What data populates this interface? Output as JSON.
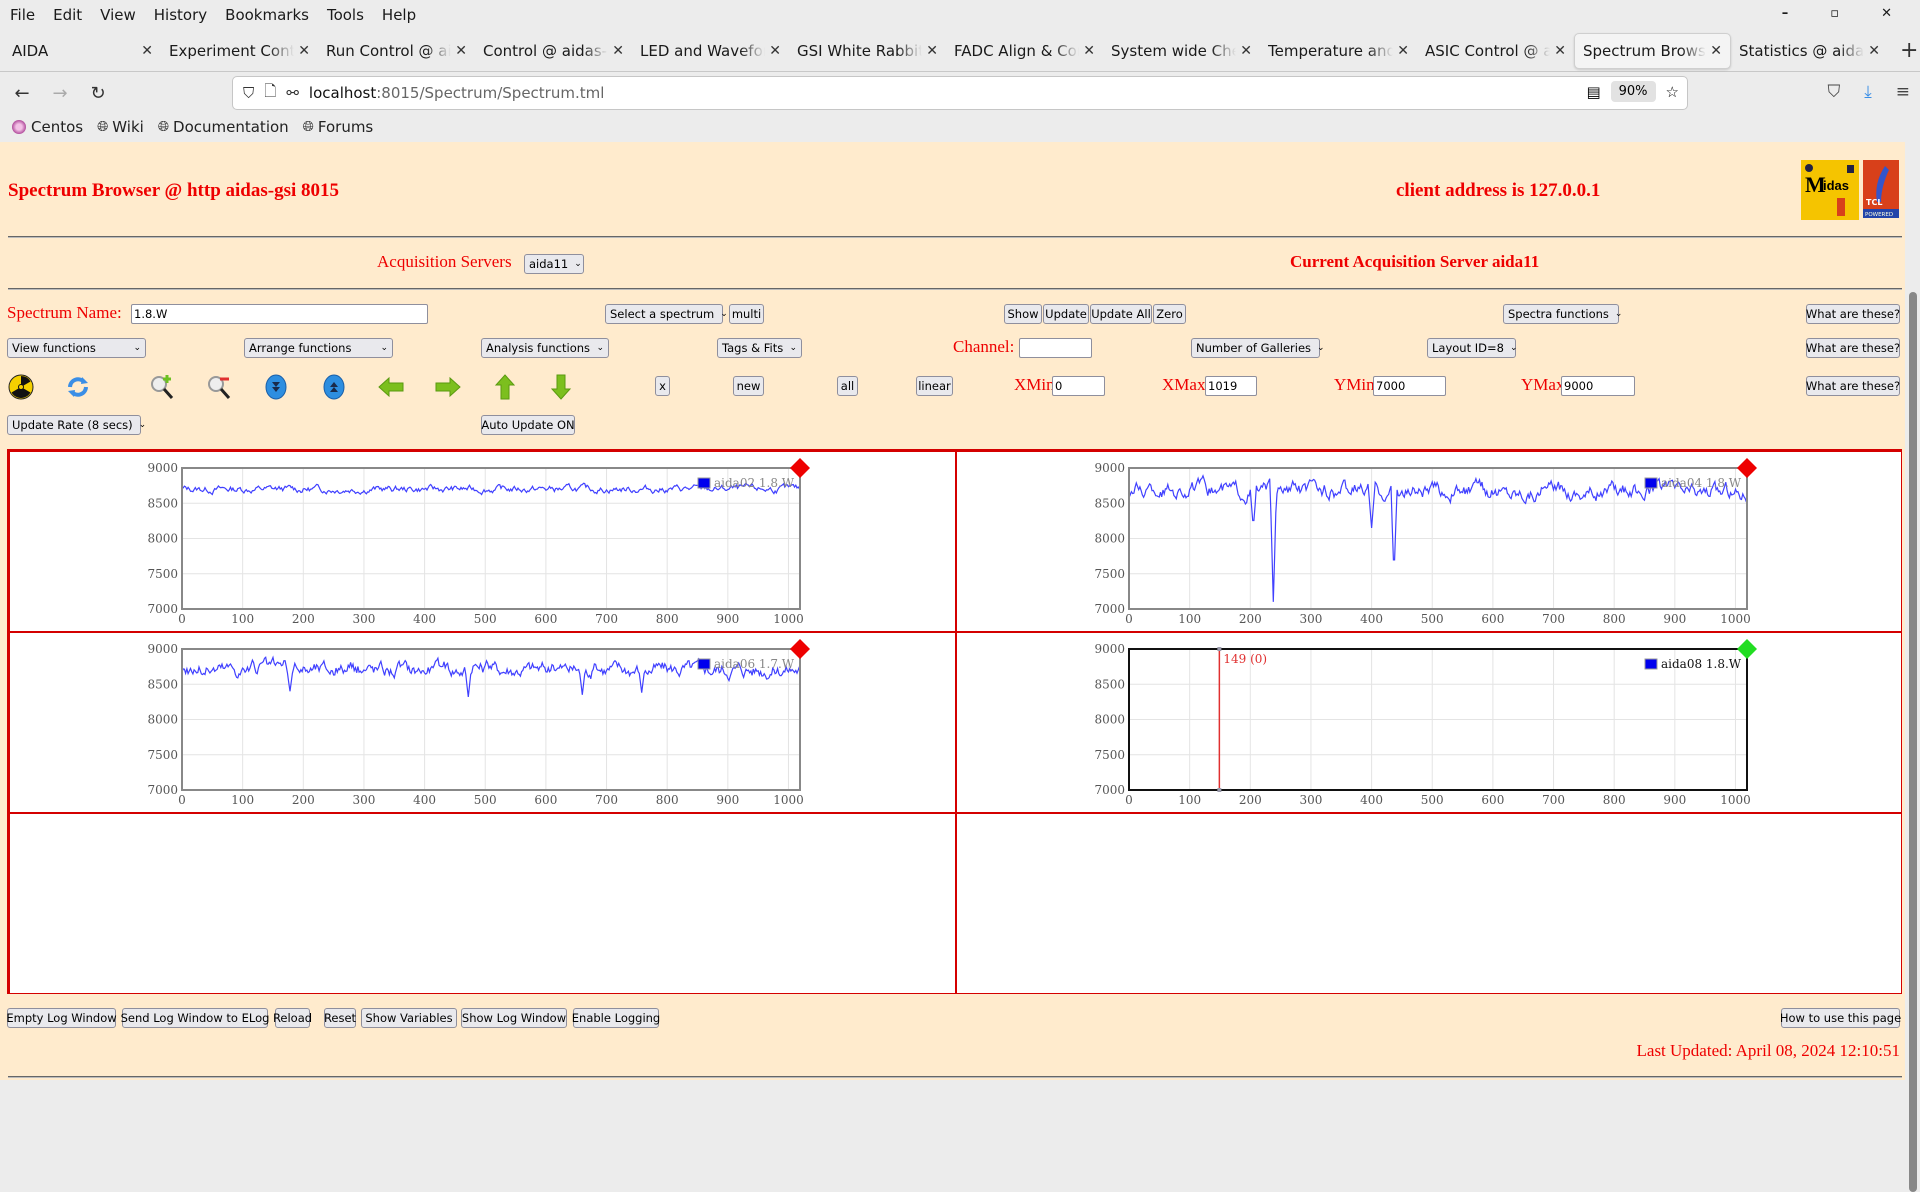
{
  "browser": {
    "menu": [
      "File",
      "Edit",
      "View",
      "History",
      "Bookmarks",
      "Tools",
      "Help"
    ],
    "window_controls": [
      "minimize",
      "maximize",
      "close"
    ],
    "tabs": [
      {
        "label": "AIDA",
        "active": false
      },
      {
        "label": "Experiment Control",
        "active": false
      },
      {
        "label": "Run Control @ aidas",
        "active": false
      },
      {
        "label": "Control @ aidas-gsi",
        "active": false
      },
      {
        "label": "LED and Waveform",
        "active": false
      },
      {
        "label": "GSI White Rabbit T",
        "active": false
      },
      {
        "label": "FADC Align & Cont",
        "active": false
      },
      {
        "label": "System wide Check",
        "active": false
      },
      {
        "label": "Temperature and s",
        "active": false
      },
      {
        "label": "ASIC Control @ aid",
        "active": false
      },
      {
        "label": "Spectrum Browser",
        "active": true
      },
      {
        "label": "Statistics @ aidas-",
        "active": false
      }
    ],
    "url_host": "localhost",
    "url_rest": ":8015/Spectrum/Spectrum.tml",
    "zoom_level": "90%",
    "bookmarks": [
      "Centos",
      "Wiki",
      "Documentation",
      "Forums"
    ]
  },
  "header": {
    "title": "Spectrum Browser @ http aidas-gsi 8015",
    "client_address": "client address is 127.0.0.1",
    "acquisition_servers_label": "Acquisition Servers",
    "acquisition_server_selected": "aida11",
    "current_server": "Current Acquisition Server aida11"
  },
  "controls": {
    "spectrum_name_label": "Spectrum Name:",
    "spectrum_name_value": "1.8.W",
    "select_spectrum": "Select a spectrum",
    "multi": "multi",
    "show": "Show",
    "update": "Update",
    "update_all": "Update All",
    "zero": "Zero",
    "spectra_functions": "Spectra functions",
    "what_are_these": "What are these?",
    "view_functions": "View functions",
    "arrange_functions": "Arrange functions",
    "analysis_functions": "Analysis functions",
    "tags_fits": "Tags & Fits",
    "channel_label": "Channel:",
    "channel_value": "",
    "number_of_galleries": "Number of Galleries",
    "layout_id": "Layout ID=8",
    "x_btn": "x",
    "new_btn": "new",
    "all_btn": "all",
    "linear_btn": "linear",
    "xmin_label": "XMin",
    "xmin_value": "0",
    "xmax_label": "XMax",
    "xmax_value": "1019",
    "ymin_label": "YMin",
    "ymin_value": "7000",
    "ymax_label": "YMax",
    "ymax_value": "9000",
    "update_rate": "Update Rate (8 secs)",
    "auto_update": "Auto Update ON",
    "icons": [
      "radiation-icon",
      "refresh-icon",
      "zoom-in-icon",
      "zoom-out-icon",
      "expand-down-icon",
      "expand-up-icon",
      "arrow-left-icon",
      "arrow-right-icon",
      "arrow-up-icon",
      "arrow-down-icon"
    ]
  },
  "footer": {
    "buttons": [
      "Empty Log Window",
      "Send Log Window to ELog",
      "Reload",
      "Reset",
      "Show Variables",
      "Show Log Window",
      "Enable Logging"
    ],
    "help": "How to use this page",
    "last_updated": "Last Updated: April 08, 2024 12:10:51"
  },
  "chart_data": [
    {
      "type": "line",
      "title": "",
      "legend": "aida02 1.8.W",
      "series_color": "#4040ff",
      "status_marker": "red",
      "xlim": [
        0,
        1019
      ],
      "ylim": [
        7000,
        9000
      ],
      "xticks": [
        0,
        100,
        200,
        300,
        400,
        500,
        600,
        700,
        800,
        900,
        1000
      ],
      "yticks": [
        7000,
        7500,
        8000,
        8500,
        9000
      ],
      "grid": true,
      "profile": {
        "mean": 8700,
        "noise": 80,
        "dips": []
      }
    },
    {
      "type": "line",
      "title": "",
      "legend": "aida04 1.8.W",
      "series_color": "#4040ff",
      "status_marker": "red",
      "xlim": [
        0,
        1019
      ],
      "ylim": [
        7000,
        9000
      ],
      "xticks": [
        0,
        100,
        200,
        300,
        400,
        500,
        600,
        700,
        800,
        900,
        1000
      ],
      "yticks": [
        7000,
        7500,
        8000,
        8500,
        9000
      ],
      "grid": true,
      "profile": {
        "mean": 8680,
        "noise": 180,
        "dips": [
          [
            205,
            8150
          ],
          [
            238,
            7100
          ],
          [
            400,
            8150
          ],
          [
            437,
            7450
          ]
        ]
      }
    },
    {
      "type": "line",
      "title": "",
      "legend": "aida06 1.7.W",
      "series_color": "#4040ff",
      "status_marker": "red",
      "xlim": [
        0,
        1019
      ],
      "ylim": [
        7000,
        9000
      ],
      "xticks": [
        0,
        100,
        200,
        300,
        400,
        500,
        600,
        700,
        800,
        900,
        1000
      ],
      "yticks": [
        7000,
        7500,
        8000,
        8500,
        9000
      ],
      "grid": true,
      "profile": {
        "mean": 8720,
        "noise": 170,
        "dips": [
          [
            178,
            8400
          ],
          [
            472,
            8320
          ],
          [
            660,
            8350
          ],
          [
            758,
            8380
          ]
        ]
      }
    },
    {
      "type": "line",
      "title": "",
      "legend": "aida08 1.8.W",
      "series_color": "#4040ff",
      "status_marker": "green",
      "xlim": [
        0,
        1019
      ],
      "ylim": [
        7000,
        9000
      ],
      "xticks": [
        0,
        100,
        200,
        300,
        400,
        500,
        600,
        700,
        800,
        900,
        1000
      ],
      "yticks": [
        7000,
        7500,
        8000,
        8500,
        9000
      ],
      "grid": true,
      "cursor": {
        "x": 149,
        "label": "149 (0)"
      },
      "profile": null
    }
  ]
}
